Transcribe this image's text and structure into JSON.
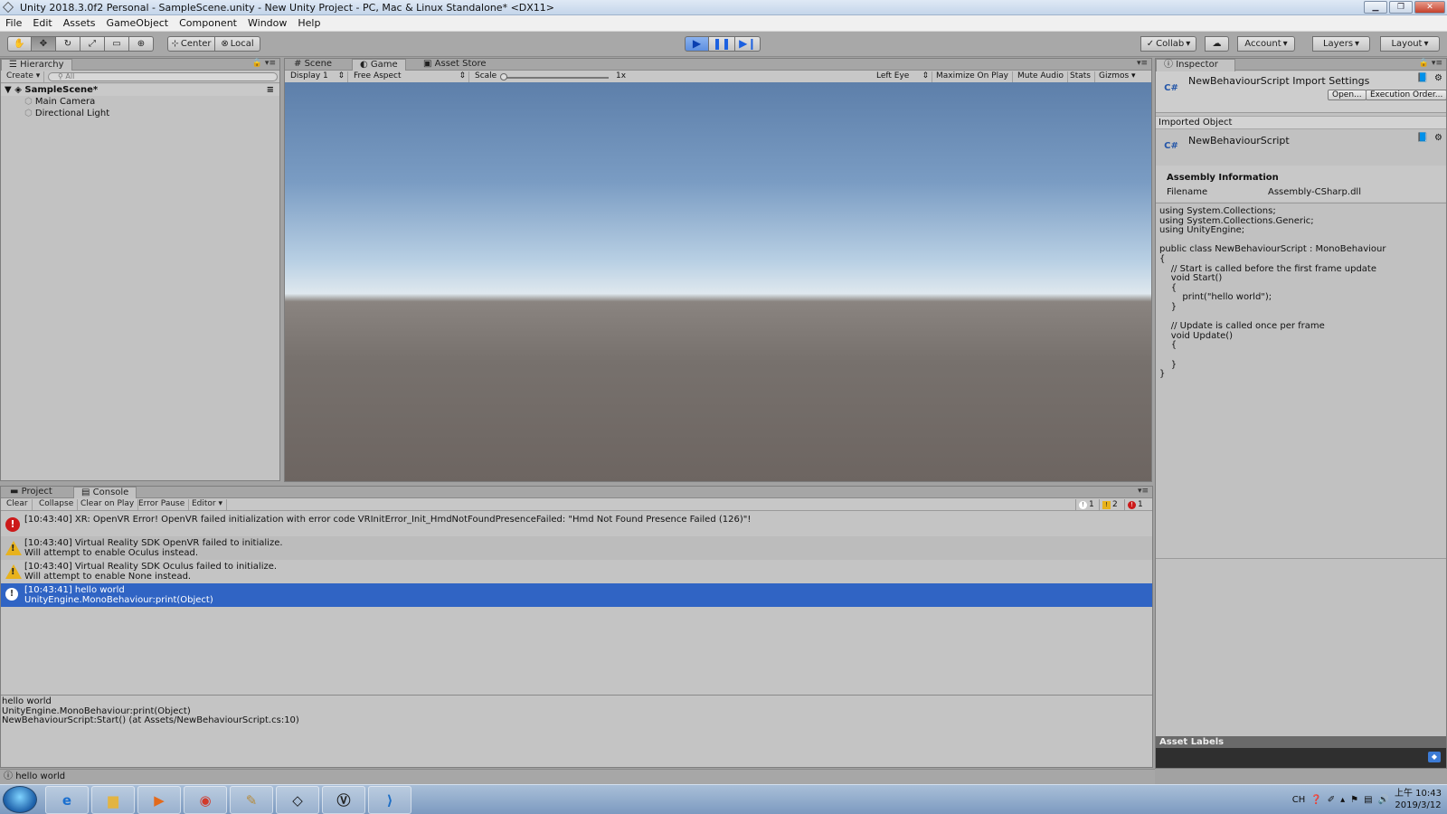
{
  "window": {
    "title": "Unity 2018.3.0f2 Personal - SampleScene.unity - New Unity Project - PC, Mac & Linux Standalone* <DX11>"
  },
  "menu": [
    "File",
    "Edit",
    "Assets",
    "GameObject",
    "Component",
    "Window",
    "Help"
  ],
  "toolbar": {
    "pivot_center": "Center",
    "pivot_local": "Local",
    "collab": "Collab",
    "account": "Account",
    "layers": "Layers",
    "layout": "Layout"
  },
  "hierarchy": {
    "tab": "Hierarchy",
    "create": "Create",
    "search_placeholder": "All",
    "scene": "SampleScene*",
    "items": [
      "Main Camera",
      "Directional Light"
    ]
  },
  "game_tabs": [
    "Scene",
    "Game",
    "Asset Store"
  ],
  "game_bar": {
    "display": "Display 1",
    "aspect": "Free Aspect",
    "scale_label": "Scale",
    "scale_value": "1x",
    "eye": "Left Eye",
    "maximize": "Maximize On Play",
    "mute": "Mute Audio",
    "stats": "Stats",
    "gizmos": "Gizmos"
  },
  "inspector": {
    "tab": "Inspector",
    "title": "NewBehaviourScript Import Settings",
    "open_btn": "Open...",
    "exec_order_btn": "Execution Order...",
    "imported_object_label": "Imported Object",
    "object_name": "NewBehaviourScript",
    "cs_label": "C#",
    "assembly_title": "Assembly Information",
    "filename_label": "Filename",
    "filename_value": "Assembly-CSharp.dll",
    "code": [
      "using System.Collections;",
      "using System.Collections.Generic;",
      "using UnityEngine;",
      "",
      "public class NewBehaviourScript : MonoBehaviour",
      "{",
      "    // Start is called before the first frame update",
      "    void Start()",
      "    {",
      "        print(\"hello world\");",
      "    }",
      "",
      "    // Update is called once per frame",
      "    void Update()",
      "    {",
      "",
      "    }",
      "}"
    ],
    "asset_labels": "Asset Labels"
  },
  "console": {
    "tabs": [
      "Project",
      "Console"
    ],
    "buttons": [
      "Clear",
      "Collapse",
      "Clear on Play",
      "Error Pause",
      "Editor"
    ],
    "counts": {
      "info": "1",
      "warn": "2",
      "error": "1"
    },
    "logs": [
      {
        "type": "error",
        "line1": "[10:43:40] XR: OpenVR Error! OpenVR failed initialization with error code VRInitError_Init_HmdNotFoundPresenceFailed: \"Hmd Not Found Presence Failed (126)\"!",
        "line2": ""
      },
      {
        "type": "warn",
        "line1": "[10:43:40] Virtual Reality SDK OpenVR failed to initialize.",
        "line2": "Will attempt to enable Oculus instead."
      },
      {
        "type": "warn",
        "line1": "[10:43:40] Virtual Reality SDK Oculus failed to initialize.",
        "line2": "Will attempt to enable None instead."
      },
      {
        "type": "info",
        "line1": "[10:43:41] hello world",
        "line2": "UnityEngine.MonoBehaviour:print(Object)"
      }
    ],
    "detail": [
      "hello world",
      "UnityEngine.MonoBehaviour:print(Object)",
      "NewBehaviourScript:Start() (at Assets/NewBehaviourScript.cs:10)"
    ]
  },
  "statusbar": {
    "text": "hello world"
  },
  "taskbar": {
    "clock_time": "上午 10:43",
    "clock_date": "2019/3/12",
    "lang": "CH"
  },
  "colors": {
    "selected_row": "#3064c4",
    "play_active": "#5d8fe0"
  }
}
